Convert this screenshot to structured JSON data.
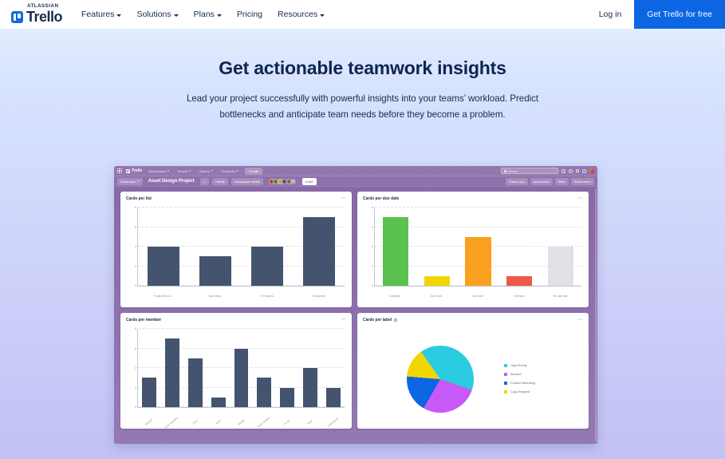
{
  "nav": {
    "brand_top": "ATLASSIAN",
    "brand": "Trello",
    "items": [
      {
        "label": "Features",
        "has_caret": true
      },
      {
        "label": "Solutions",
        "has_caret": true
      },
      {
        "label": "Plans",
        "has_caret": true
      },
      {
        "label": "Pricing",
        "has_caret": false
      },
      {
        "label": "Resources",
        "has_caret": true
      }
    ],
    "login": "Log in",
    "cta": "Get Trello for free",
    "cta_color": "#0C66E4"
  },
  "hero": {
    "title": "Get actionable teamwork insights",
    "body": "Lead your project successfully with powerful insights into your teams’ workload. Predict bottlenecks and anticipate team needs before they become a problem."
  },
  "app": {
    "topbar": {
      "logo": "Trello",
      "menus": [
        "Workspaces",
        "Recent",
        "Starred",
        "Templates"
      ],
      "create": "Create",
      "search_placeholder": "Search"
    },
    "boardbar": {
      "workspace": "Dashboard",
      "title": "Asset Design Project",
      "jira": "Infinite",
      "visibility": "Workspace visible",
      "overflow_count": "+1",
      "invite": "Invite",
      "powerups": "Power-Ups",
      "automation": "Automation",
      "filter": "Filter",
      "menu": "Show menu"
    }
  },
  "chart_data": [
    {
      "type": "bar",
      "title": "Cards per list",
      "categories": [
        "Project Resou...",
        "Upcoming",
        "In Progress",
        "Completed"
      ],
      "values": [
        4,
        3,
        4,
        7
      ],
      "yticks": [
        0,
        2,
        4,
        6,
        8
      ],
      "ylim": [
        0,
        8
      ],
      "color": "#44546F",
      "grid": true
    },
    {
      "type": "bar",
      "title": "Cards per due date",
      "categories": [
        "Complete",
        "Due soon",
        "Due later",
        "Overdue",
        "No due date"
      ],
      "values": [
        7,
        1,
        5,
        1,
        4
      ],
      "colors": [
        "#5BC14E",
        "#F2D600",
        "#FAA01E",
        "#EB5A46",
        "#DFE1E6"
      ],
      "yticks": [
        0,
        2,
        4,
        6,
        8
      ],
      "ylim": [
        0,
        8
      ],
      "grid": true
    },
    {
      "type": "bar",
      "title": "Cards per member",
      "categories": [
        "Samuel",
        "Anna Vangelis...",
        "Chris",
        "Henri",
        "Nikolla",
        "Taylor Skyline",
        "Lucas",
        "Patel",
        "Unassigned"
      ],
      "values": [
        3,
        7,
        5,
        1,
        6,
        3,
        2,
        4,
        2
      ],
      "yticks": [
        0,
        2,
        4,
        6,
        8
      ],
      "ylim": [
        0,
        8
      ],
      "color": "#44546F",
      "grid": true
    },
    {
      "type": "pie",
      "title": "Cards per label",
      "labels": [
        "High Priority",
        "Blocked",
        "Product Marketing",
        "Copy Request"
      ],
      "values": [
        40,
        28,
        18,
        14
      ],
      "colors": [
        "#2BCCE2",
        "#C униt"
      ],
      "slice_colors": [
        "#2BCCE2",
        "#C75AF6",
        "#0C66E4",
        "#F2D600"
      ],
      "legend_position": "right"
    }
  ]
}
